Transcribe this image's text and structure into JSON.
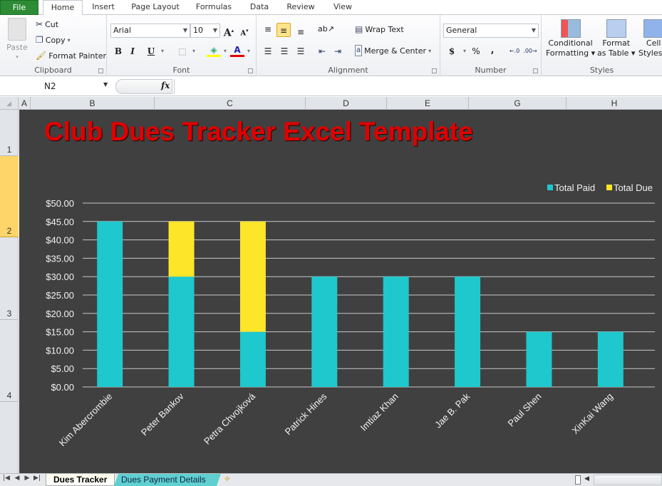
{
  "tabs": [
    "File",
    "Home",
    "Insert",
    "Page Layout",
    "Formulas",
    "Data",
    "Review",
    "View"
  ],
  "active_tab": "Home",
  "ribbon": {
    "clipboard": {
      "paste": "Paste",
      "cut": "Cut",
      "copy": "Copy",
      "format_painter": "Format Painter",
      "label": "Clipboard"
    },
    "font": {
      "name": "Arial",
      "size": "10",
      "bold": "B",
      "italic": "I",
      "underline": "U",
      "label": "Font",
      "fill_color": "#ffff00",
      "font_color": "#e00000"
    },
    "alignment": {
      "wrap_text": "Wrap Text",
      "merge_center": "Merge & Center",
      "label": "Alignment"
    },
    "number": {
      "format": "General",
      "currency": "$",
      "percent": "%",
      "comma": ",",
      "label": "Number"
    },
    "styles": {
      "conditional": "Conditional",
      "conditional2": "Formatting",
      "format_as": "Format",
      "format_as2": "as Table",
      "cell": "Cell",
      "cell2": "Styles",
      "label": "Styles"
    }
  },
  "formula_bar": {
    "name_box": "N2",
    "fx": "fx",
    "formula": ""
  },
  "columns": [
    "A",
    "B",
    "C",
    "D",
    "E",
    "G",
    "H"
  ],
  "rows": [
    "1",
    "2",
    "3",
    "4"
  ],
  "sheet_title": "Club Dues Tracker Excel Template",
  "sheet_tabs": [
    "Dues Tracker",
    "Dues Payment Details"
  ],
  "active_sheet": "Dues Tracker",
  "chart_data": {
    "type": "bar",
    "stacked": true,
    "title": "",
    "categories": [
      "Kim Abercrombie",
      "Peter Bankov",
      "Petra Chvojková",
      "Patrick Hines",
      "Imtiaz Khan",
      "Jae B. Pak",
      "Paul Shen",
      "XinKai Wang"
    ],
    "series": [
      {
        "name": "Total Paid",
        "color": "#1ec8cc",
        "values": [
          45,
          30,
          15,
          30,
          30,
          30,
          15,
          15
        ]
      },
      {
        "name": "Total Due",
        "color": "#fde52a",
        "values": [
          0,
          15,
          30,
          0,
          0,
          0,
          0,
          0
        ]
      }
    ],
    "ylim": [
      0,
      50
    ],
    "ytick_step": 5,
    "ytick_labels": [
      "$0.00",
      "$5.00",
      "$10.00",
      "$15.00",
      "$20.00",
      "$25.00",
      "$30.00",
      "$35.00",
      "$40.00",
      "$45.00",
      "$50.00"
    ],
    "xlabel": "",
    "ylabel": "",
    "grid": true,
    "legend": "top-right"
  }
}
